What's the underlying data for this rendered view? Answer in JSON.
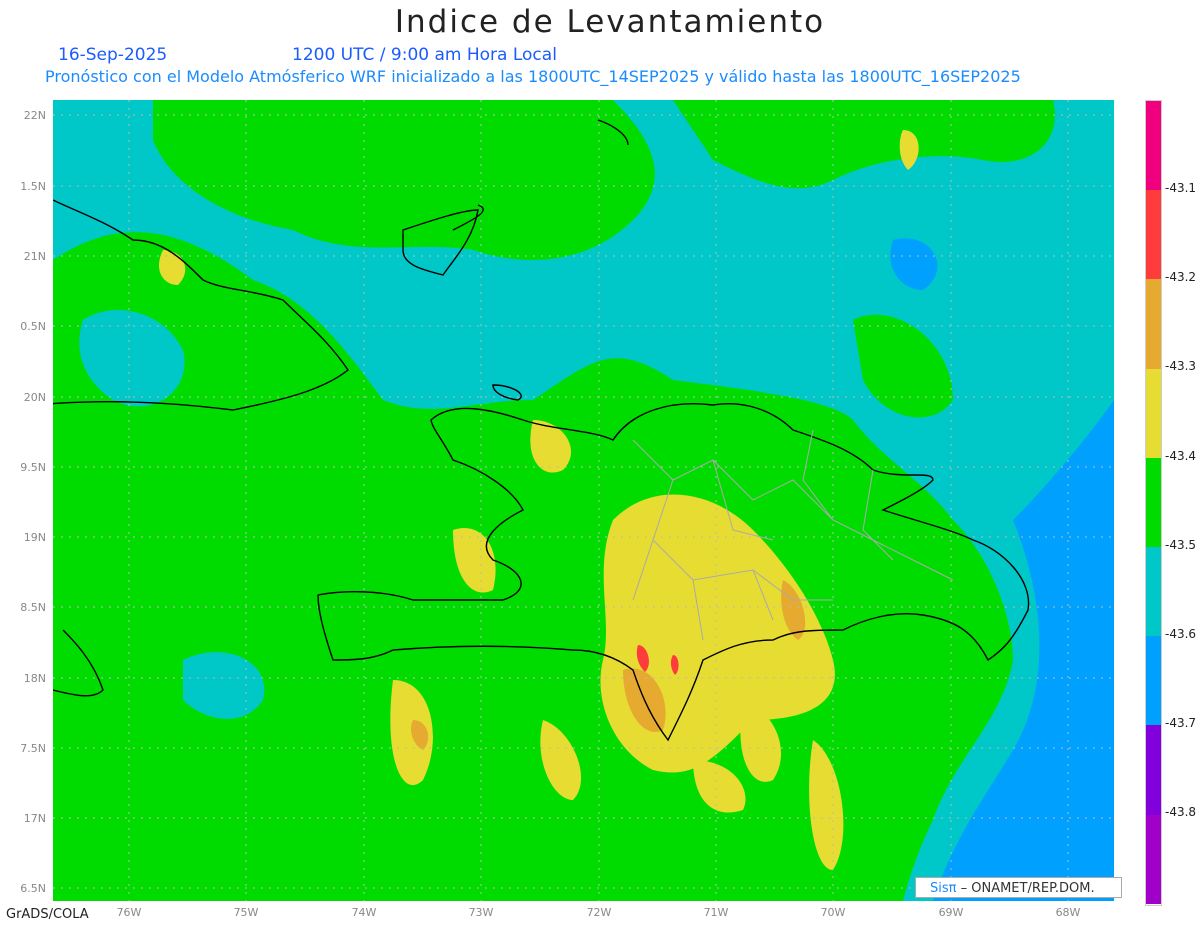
{
  "header": {
    "title": "Indice de Levantamiento",
    "date": "16-Sep-2025",
    "time": "1200 UTC / 9:00 am Hora Local",
    "subtitle": "Pronóstico con el Modelo Atmósferico WRF inicializado a las 1800UTC_14SEP2025 y válido hasta las  1800UTC_16SEP2025"
  },
  "axes": {
    "y_labels": [
      "22N",
      "1.5N",
      "21N",
      "0.5N",
      "20N",
      "9.5N",
      "19N",
      "8.5N",
      "18N",
      "7.5N",
      "17N",
      "6.5N"
    ],
    "x_labels": [
      "76W",
      "75W",
      "74W",
      "73W",
      "72W",
      "71W",
      "70W",
      "69W",
      "68W"
    ]
  },
  "colorbar": {
    "colors": [
      "#f0007f",
      "#ff3c3c",
      "#e6aa30",
      "#e6dc32",
      "#00dc00",
      "#00c8c8",
      "#00a0ff",
      "#8200dc",
      "#a000c8"
    ],
    "labels": [
      "-43.1",
      "-43.2",
      "-43.3",
      "-43.4",
      "-43.5",
      "-43.6",
      "-43.7",
      "-43.8"
    ]
  },
  "credit": {
    "logo": "Sisπ",
    "text": " –  ONAMET/REP.DOM."
  },
  "footer": {
    "software": "GrADS/COLA"
  }
}
